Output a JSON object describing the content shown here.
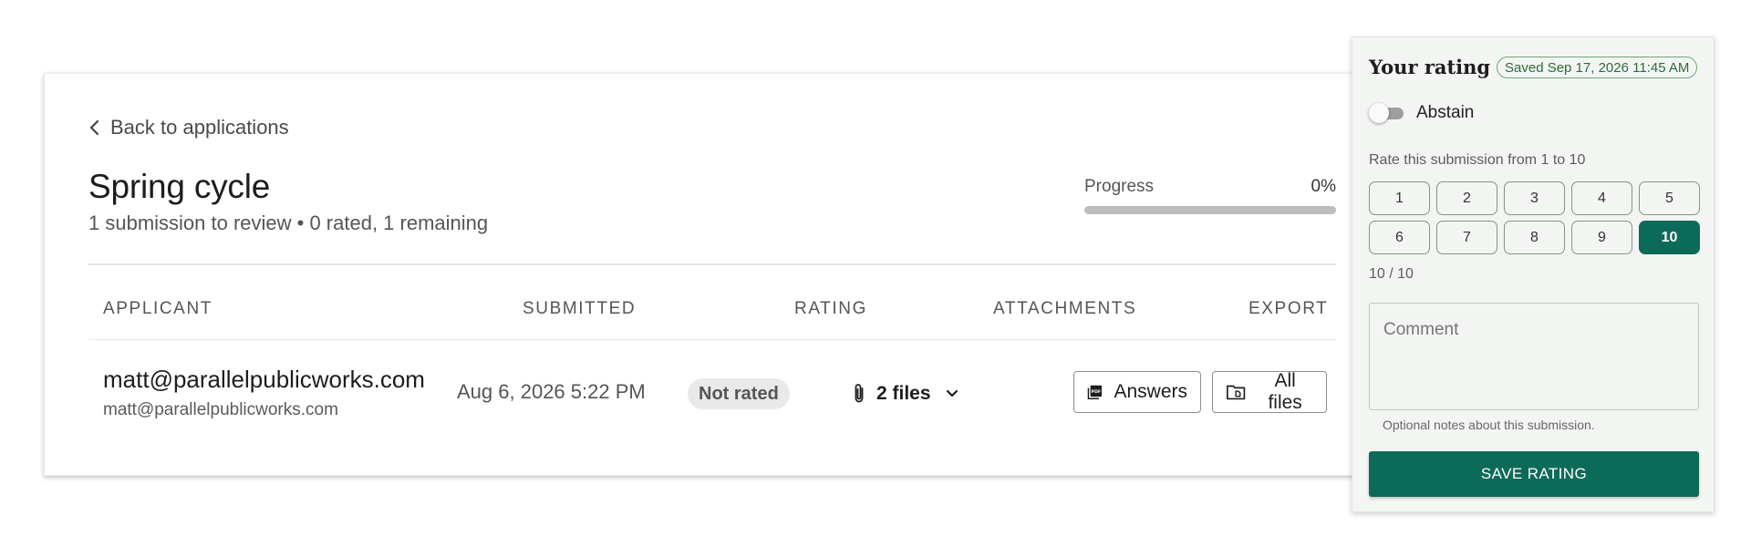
{
  "nav": {
    "back_label": "Back to applications"
  },
  "header": {
    "title": "Spring cycle",
    "subtitle": "1 submission to review • 0 rated, 1 remaining"
  },
  "progress": {
    "label": "Progress",
    "value_text": "0%",
    "fraction": 0
  },
  "table": {
    "columns": [
      "APPLICANT",
      "SUBMITTED",
      "RATING",
      "ATTACHMENTS",
      "EXPORT"
    ],
    "rows": [
      {
        "applicant_primary": "matt@parallelpublicworks.com",
        "applicant_secondary": "matt@parallelpublicworks.com",
        "submitted": "Aug 6, 2026 5:22 PM",
        "rating": "Not rated",
        "attachments": "2 files",
        "export_answers": "Answers",
        "export_all_files": "All files"
      }
    ]
  },
  "rating_panel": {
    "title": "Your rating",
    "saved_status": "Saved Sep 17, 2026 11:45 AM",
    "abstain_label": "Abstain",
    "abstain_on": false,
    "rate_prompt": "Rate this submission from 1 to 10",
    "scores": [
      "1",
      "2",
      "3",
      "4",
      "5",
      "6",
      "7",
      "8",
      "9",
      "10"
    ],
    "selected_score": "10",
    "score_readout": "10 / 10",
    "comment_placeholder": "Comment",
    "comment_help": "Optional notes about this submission.",
    "save_label": "SAVE RATING"
  },
  "colors": {
    "accent": "#0c6b58",
    "saved_chip": "#2f6a3c",
    "badge_bg": "#e9e9e9"
  },
  "icons": {
    "back": "chevron-left-icon",
    "attachments": "paperclip-icon",
    "dropdown": "chevron-down-icon",
    "answers": "pdf-icon",
    "all_files": "folder-icon"
  }
}
